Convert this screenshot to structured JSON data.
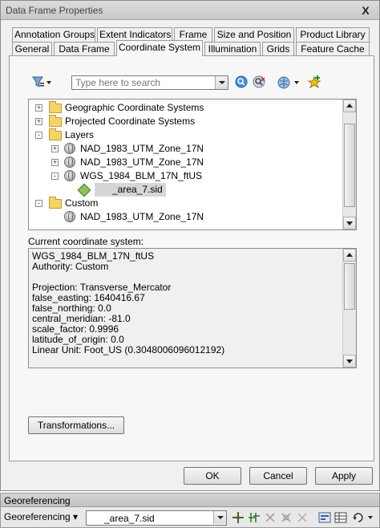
{
  "window": {
    "title": "Data Frame Properties",
    "close_glyph": "X"
  },
  "tabs": {
    "row1": [
      "Annotation Groups",
      "Extent Indicators",
      "Frame",
      "Size and Position",
      "Product Library"
    ],
    "row2": [
      "General",
      "Data Frame",
      "Coordinate System",
      "Illumination",
      "Grids",
      "Feature Cache"
    ],
    "active": "Coordinate System"
  },
  "toolbar": {
    "search_placeholder": "Type here to search",
    "icons": [
      "filter-icon",
      "search-icon",
      "clear-search-icon",
      "globe-icon",
      "add-favorite-icon"
    ]
  },
  "tree": {
    "items": [
      {
        "label": "Geographic Coordinate Systems",
        "icon": "folder-icon",
        "expander": "+"
      },
      {
        "label": "Projected Coordinate Systems",
        "icon": "folder-icon",
        "expander": "+"
      },
      {
        "label": "Layers",
        "icon": "folder-open-icon",
        "expander": "-"
      },
      {
        "label": "NAD_1983_UTM_Zone_17N",
        "icon": "globe-icon",
        "expander": "+"
      },
      {
        "label": "NAD_1983_UTM_Zone_17N",
        "icon": "globe-icon",
        "expander": "+"
      },
      {
        "label": "WGS_1984_BLM_17N_ftUS",
        "icon": "globe-icon",
        "expander": "-"
      },
      {
        "label": "_area_7.sid",
        "icon": "raster-icon",
        "expander": ""
      },
      {
        "label": "Custom",
        "icon": "folder-open-icon",
        "expander": "-"
      },
      {
        "label": "NAD_1983_UTM_Zone_17N",
        "icon": "globe-icon",
        "expander": ""
      }
    ]
  },
  "current_cs": {
    "label": "Current coordinate system:",
    "lines": [
      "WGS_1984_BLM_17N_ftUS",
      "Authority: Custom",
      "",
      "Projection: Transverse_Mercator",
      "false_easting: 1640416.67",
      "false_northing: 0.0",
      "central_meridian: -81.0",
      "scale_factor: 0.9996",
      "latitude_of_origin: 0.0",
      "Linear Unit: Foot_US (0.3048006096012192)"
    ]
  },
  "buttons": {
    "transformations": "Transformations...",
    "ok": "OK",
    "cancel": "Cancel",
    "apply": "Apply"
  },
  "georef": {
    "title": "Georeferencing",
    "menu_label": "Georeferencing ▾",
    "layer_value": "_area_7.sid"
  }
}
